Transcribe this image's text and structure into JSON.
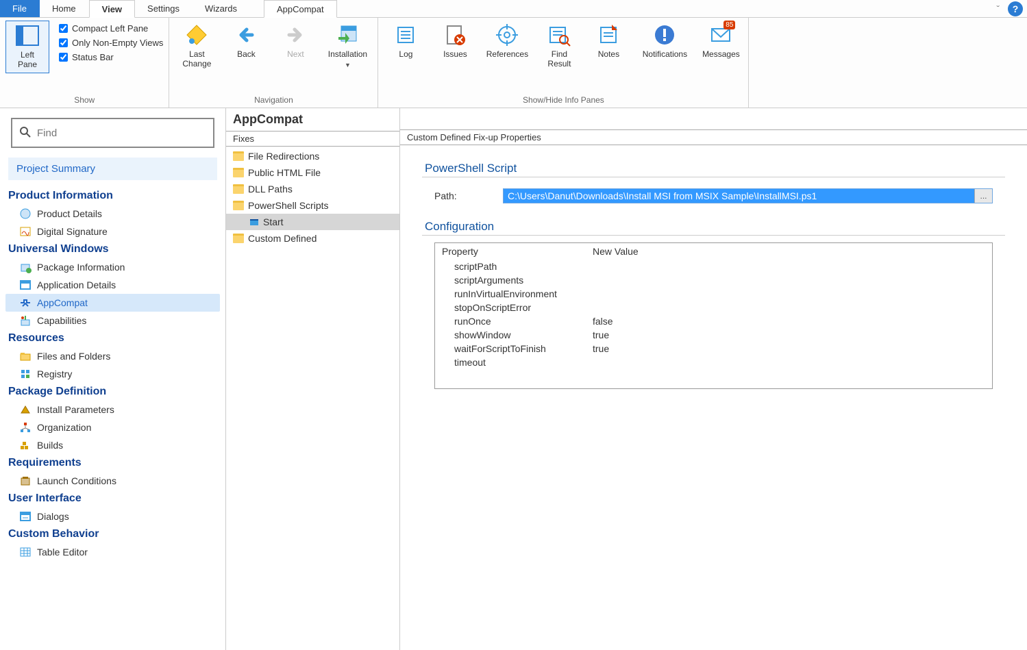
{
  "tabs": {
    "file": "File",
    "home": "Home",
    "view": "View",
    "settings": "Settings",
    "wizards": "Wizards",
    "appcompat": "AppCompat"
  },
  "ribbon": {
    "show": {
      "label": "Show",
      "leftpane": "Left\nPane",
      "compact": "Compact Left Pane",
      "nonempty": "Only Non-Empty Views",
      "statusbar": "Status Bar"
    },
    "nav": {
      "label": "Navigation",
      "lastchange": "Last\nChange",
      "back": "Back",
      "next": "Next",
      "installation": "Installation"
    },
    "panes": {
      "label": "Show/Hide Info Panes",
      "log": "Log",
      "issues": "Issues",
      "references": "References",
      "findresult": "Find\nResult",
      "notes": "Notes",
      "notifications": "Notifications",
      "messages": "Messages",
      "message_count": "85"
    }
  },
  "search": {
    "placeholder": "Find"
  },
  "leftnav": {
    "summary": "Project Summary",
    "groups": [
      {
        "heading": "Product Information",
        "items": [
          "Product Details",
          "Digital Signature"
        ]
      },
      {
        "heading": "Universal Windows",
        "items": [
          "Package Information",
          "Application Details",
          "AppCompat",
          "Capabilities"
        ],
        "selected": "AppCompat"
      },
      {
        "heading": "Resources",
        "items": [
          "Files and Folders",
          "Registry"
        ]
      },
      {
        "heading": "Package Definition",
        "items": [
          "Install Parameters",
          "Organization",
          "Builds"
        ]
      },
      {
        "heading": "Requirements",
        "items": [
          "Launch Conditions"
        ]
      },
      {
        "heading": "User Interface",
        "items": [
          "Dialogs"
        ]
      },
      {
        "heading": "Custom Behavior",
        "items": [
          "Table Editor"
        ]
      }
    ]
  },
  "mid": {
    "title": "AppCompat",
    "header": "Fixes",
    "tree": [
      {
        "label": "File Redirections"
      },
      {
        "label": "Public HTML File"
      },
      {
        "label": "DLL Paths"
      },
      {
        "label": "PowerShell Scripts",
        "children": [
          {
            "label": "Start",
            "selected": true
          }
        ]
      },
      {
        "label": "Custom Defined"
      }
    ]
  },
  "right": {
    "header": "Custom Defined Fix-up Properties",
    "script_section": "PowerShell Script",
    "path_label": "Path:",
    "path_value": "C:\\Users\\Danut\\Downloads\\Install MSI from MSIX Sample\\InstallMSI.ps1",
    "browse": "...",
    "config_section": "Configuration",
    "columns": {
      "prop": "Property",
      "val": "New Value"
    },
    "rows": [
      {
        "prop": "scriptPath",
        "val": ""
      },
      {
        "prop": "scriptArguments",
        "val": ""
      },
      {
        "prop": "runInVirtualEnvironment",
        "val": ""
      },
      {
        "prop": "stopOnScriptError",
        "val": ""
      },
      {
        "prop": "runOnce",
        "val": "false"
      },
      {
        "prop": "showWindow",
        "val": "true"
      },
      {
        "prop": "waitForScriptToFinish",
        "val": "true"
      },
      {
        "prop": "timeout",
        "val": ""
      }
    ]
  }
}
